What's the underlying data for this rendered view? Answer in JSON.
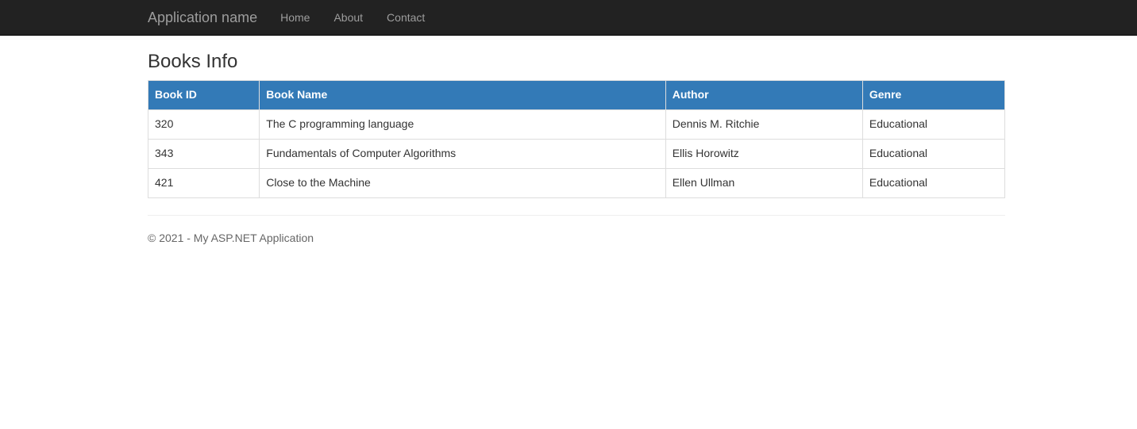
{
  "navbar": {
    "brand": "Application name",
    "items": [
      {
        "label": "Home"
      },
      {
        "label": "About"
      },
      {
        "label": "Contact"
      }
    ]
  },
  "page": {
    "title": "Books Info"
  },
  "books_table": {
    "columns": [
      "Book ID",
      "Book Name",
      "Author",
      "Genre"
    ],
    "rows": [
      [
        "320",
        "The C programming language",
        "Dennis M. Ritchie",
        "Educational"
      ],
      [
        "343",
        "Fundamentals of Computer Algorithms",
        "Ellis Horowitz",
        "Educational"
      ],
      [
        "421",
        "Close to the Machine",
        "Ellen Ullman",
        "Educational"
      ]
    ]
  },
  "footer": {
    "copyright": "© 2021 - My ASP.NET Application"
  },
  "colors": {
    "navbar_bg": "#222222",
    "navbar_text": "#9d9d9d",
    "table_header_bg": "#337ab7",
    "table_header_text": "#ffffff",
    "table_border": "#dddddd",
    "body_text": "#333333"
  }
}
